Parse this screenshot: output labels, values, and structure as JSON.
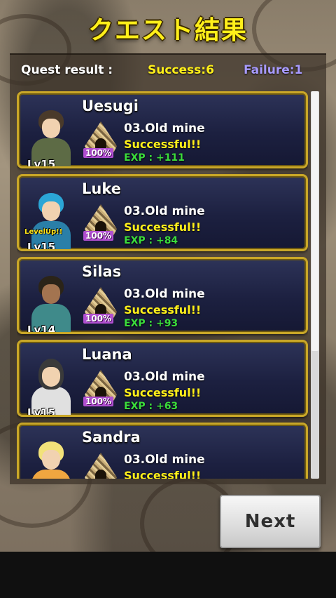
{
  "title": "クエスト結果",
  "summary": {
    "label": "Quest result :",
    "success": "Success:6",
    "failure": "Failure:1"
  },
  "results": [
    {
      "name": "Uesugi",
      "level": "Lv15",
      "quest": "03.Old mine",
      "status": "Successful!!",
      "exp": "EXP : +111",
      "percent": "100%",
      "level_up": "",
      "colors": {
        "hair": "#4a3a2a",
        "body": "#5d6b45"
      }
    },
    {
      "name": "Luke",
      "level": "Lv15",
      "quest": "03.Old mine",
      "status": "Successful!!",
      "exp": "EXP : +84",
      "percent": "100%",
      "level_up": "LevelUp!!",
      "colors": {
        "hair": "#2ba6d6",
        "body": "#2a7fa8"
      }
    },
    {
      "name": "Silas",
      "level": "Lv14",
      "quest": "03.Old mine",
      "status": "Successful!!",
      "exp": "EXP : +93",
      "percent": "100%",
      "level_up": "",
      "colors": {
        "hair": "#2b2418",
        "body": "#3f8a8a"
      }
    },
    {
      "name": "Luana",
      "level": "Lv15",
      "quest": "03.Old mine",
      "status": "Successful!!",
      "exp": "EXP : +63",
      "percent": "100%",
      "level_up": "",
      "colors": {
        "hair": "#3a3a3a",
        "body": "#e0e0e0"
      }
    },
    {
      "name": "Sandra",
      "level": "",
      "quest": "03.Old mine",
      "status": "Successful!!",
      "exp": "",
      "percent": "",
      "level_up": "",
      "colors": {
        "hair": "#f2e27a",
        "body": "#f0a640"
      }
    }
  ],
  "next_button": "Next",
  "colors": {
    "title": "#ffef1a",
    "success": "#ffef1a",
    "failure": "#a89bff",
    "exp": "#3bdc3b",
    "card_border": "#c9a728"
  }
}
